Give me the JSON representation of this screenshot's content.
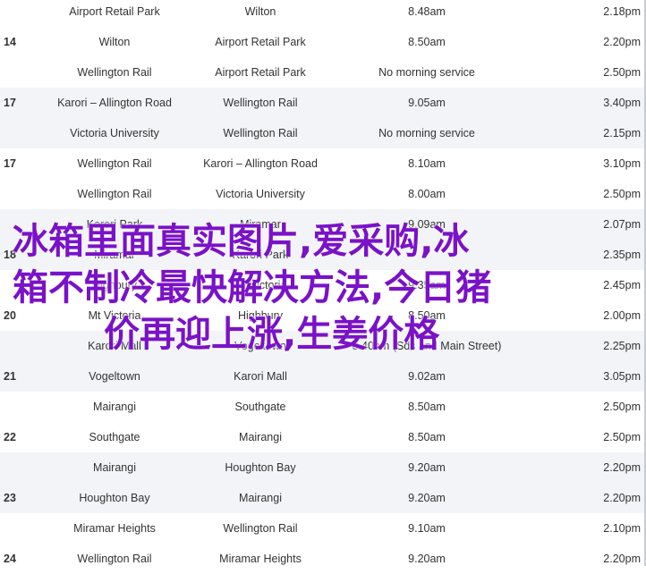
{
  "rows": [
    {
      "route": "",
      "from": "Airport Retail Park",
      "to": "Wilton",
      "am": "8.48am",
      "pm": "2.18pm"
    },
    {
      "route": "14",
      "from": "Wilton",
      "to": "Airport Retail Park",
      "am": "8.50am",
      "pm": "2.20pm"
    },
    {
      "route": "",
      "from": "Wellington Rail",
      "to": "Airport Retail Park",
      "am": "No morning service",
      "pm": "2.50pm"
    },
    {
      "route": "17",
      "from": "Karori – Allington Road",
      "to": "Wellington Rail",
      "am": "9.05am",
      "pm": "3.40pm"
    },
    {
      "route": "",
      "from": "Victoria University",
      "to": "Wellington Rail",
      "am": "No morning service",
      "pm": "2.15pm"
    },
    {
      "route": "17",
      "from": "Wellington Rail",
      "to": "Karori – Allington Road",
      "am": "8.10am",
      "pm": "3.10pm"
    },
    {
      "route": "",
      "from": "Wellington Rail",
      "to": "Victoria University",
      "am": "8.00am",
      "pm": "2.50pm"
    },
    {
      "route": "",
      "from": "Karori Park",
      "to": "Miramar",
      "am": "9.09am",
      "pm": "2.07pm"
    },
    {
      "route": "18",
      "from": "Miramar",
      "to": "Karori Park",
      "am": "",
      "pm": "2.35pm"
    },
    {
      "route": "",
      "from": "Highbury",
      "to": "Mt Victoria",
      "am": "9.35am",
      "pm": "2.45pm"
    },
    {
      "route": "20",
      "from": "Mt Victoria",
      "to": "Highbury",
      "am": "8.50am",
      "pm": "2.00pm"
    },
    {
      "route": "",
      "from": "Karori Mall",
      "to": "Vogeltown",
      "am": "8.40am (Sds and Main Street)",
      "pm": "2.25pm"
    },
    {
      "route": "21",
      "from": "Vogeltown",
      "to": "Karori Mall",
      "am": "9.02am",
      "pm": "3.05pm"
    },
    {
      "route": "",
      "from": "Mairangi",
      "to": "Southgate",
      "am": "8.50am",
      "pm": "2.50pm"
    },
    {
      "route": "22",
      "from": "Southgate",
      "to": "Mairangi",
      "am": "8.50am",
      "pm": "2.50pm"
    },
    {
      "route": "",
      "from": "Mairangi",
      "to": "Houghton Bay",
      "am": "9.20am",
      "pm": "2.20pm"
    },
    {
      "route": "23",
      "from": "Houghton Bay",
      "to": "Mairangi",
      "am": "9.20am",
      "pm": "2.20pm"
    },
    {
      "route": "",
      "from": "Miramar Heights",
      "to": "Wellington Rail",
      "am": "9.10am",
      "pm": "2.10pm"
    },
    {
      "route": "24",
      "from": "Wellington Rail",
      "to": "Miramar Heights",
      "am": "9.20am",
      "pm": "2.20pm"
    }
  ],
  "overlay": {
    "line1": "冰箱里面真实图片,爱采购,冰",
    "line2": "箱不制冷最快解决方法,今日猪",
    "line3": "价再迎上涨,生姜价格"
  }
}
